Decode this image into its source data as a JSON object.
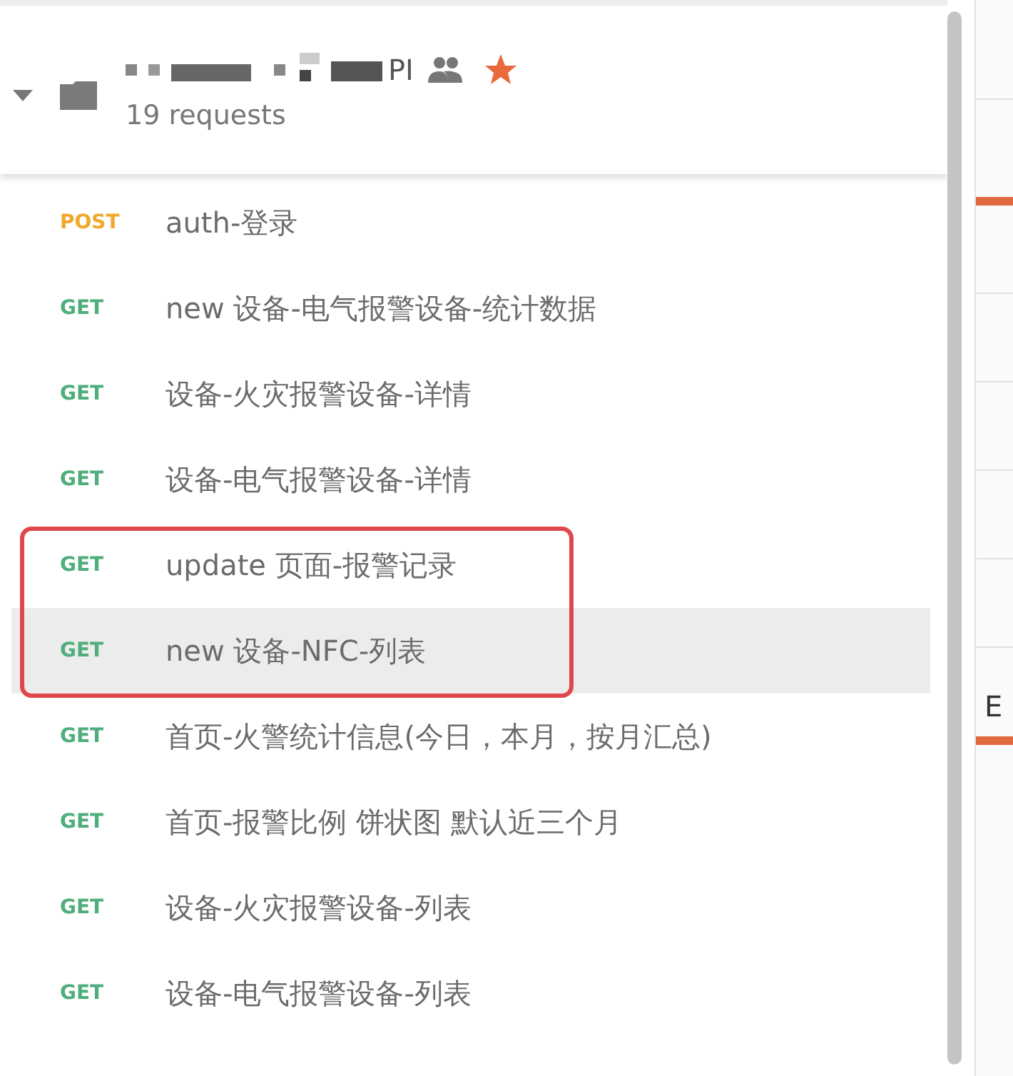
{
  "collection": {
    "title": "PI",
    "requests_count": "19 requests",
    "expanded": true,
    "starred": true
  },
  "requests": [
    {
      "method": "POST",
      "name": "auth-登录",
      "selected": false,
      "highlighted": false
    },
    {
      "method": "GET",
      "name": "new 设备-电气报警设备-统计数据",
      "selected": false,
      "highlighted": false
    },
    {
      "method": "GET",
      "name": "设备-火灾报警设备-详情",
      "selected": false,
      "highlighted": false
    },
    {
      "method": "GET",
      "name": "设备-电气报警设备-详情",
      "selected": false,
      "highlighted": false
    },
    {
      "method": "GET",
      "name": "update 页面-报警记录",
      "selected": false,
      "highlighted": true
    },
    {
      "method": "GET",
      "name": "new 设备-NFC-列表",
      "selected": true,
      "highlighted": true
    },
    {
      "method": "GET",
      "name": "首页-火警统计信息(今日，本月，按月汇总)",
      "selected": false,
      "highlighted": false
    },
    {
      "method": "GET",
      "name": "首页-报警比例 饼状图 默认近三个月",
      "selected": false,
      "highlighted": false
    },
    {
      "method": "GET",
      "name": "设备-火灾报警设备-列表",
      "selected": false,
      "highlighted": false
    },
    {
      "method": "GET",
      "name": "设备-电气报警设备-列表",
      "selected": false,
      "highlighted": false
    }
  ],
  "side_panel": {
    "tab_label": "E"
  }
}
